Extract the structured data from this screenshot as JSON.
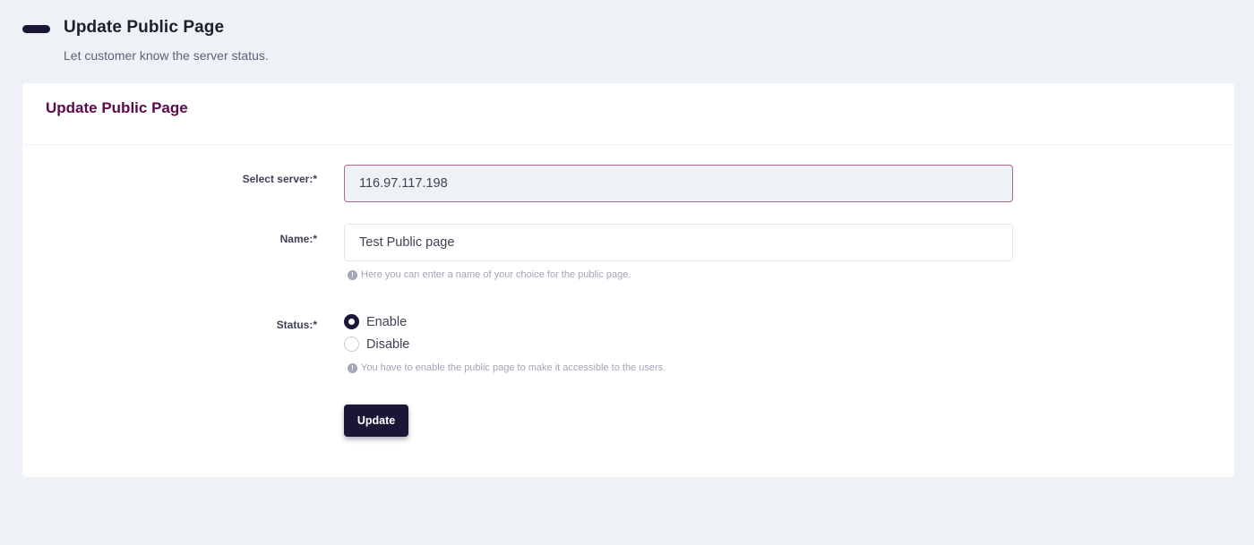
{
  "header": {
    "title": "Update Public Page",
    "subtitle": "Let customer know the server status."
  },
  "card": {
    "title": "Update Public Page"
  },
  "form": {
    "server": {
      "label": "Select server:*",
      "value": "116.97.117.198"
    },
    "name": {
      "label": "Name:*",
      "value": "Test Public page",
      "hint": "Here you can enter a name of your choice for the public page."
    },
    "status": {
      "label": "Status:*",
      "options": [
        {
          "label": "Enable",
          "checked": true
        },
        {
          "label": "Disable",
          "checked": false
        }
      ],
      "hint": "You have to enable the public page to make it accessible to the users."
    },
    "submit_label": "Update"
  },
  "colors": {
    "brand_dark": "#1b1537",
    "card_title": "#5c0a4a",
    "background": "#eef1f5"
  },
  "icons": {
    "header_icon": "minus-bar-icon",
    "hint_icon": "info-icon"
  }
}
